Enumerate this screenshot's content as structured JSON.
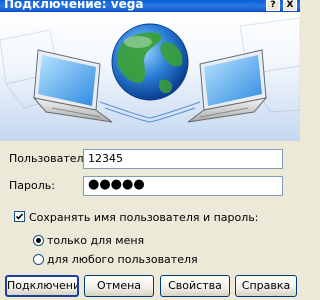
{
  "window": {
    "title": "Подключение: vega",
    "help_button": "?",
    "close_button": "X"
  },
  "form": {
    "username_label": "Пользователь:",
    "username_value": "12345",
    "password_label": "Пароль:",
    "password_value": "●●●●●",
    "save_checkbox_label": "Сохранять имя пользователя и пароль:",
    "save_checked": true,
    "radio_only_me": "только для меня",
    "radio_any_user": "для любого пользователя",
    "selected_radio": "only_me"
  },
  "buttons": {
    "connect": "Подключение",
    "cancel": "Отмена",
    "properties": "Свойства",
    "help": "Справка"
  },
  "colors": {
    "titlebar": "#0a5fd8",
    "dialog_bg": "#ece9d8",
    "globe_ocean": "#2a7fd6",
    "globe_land": "#3aa03a"
  },
  "icons": [
    "network-connection-icon",
    "globe-icon",
    "laptop-icon",
    "check-icon",
    "help-icon",
    "close-icon"
  ]
}
